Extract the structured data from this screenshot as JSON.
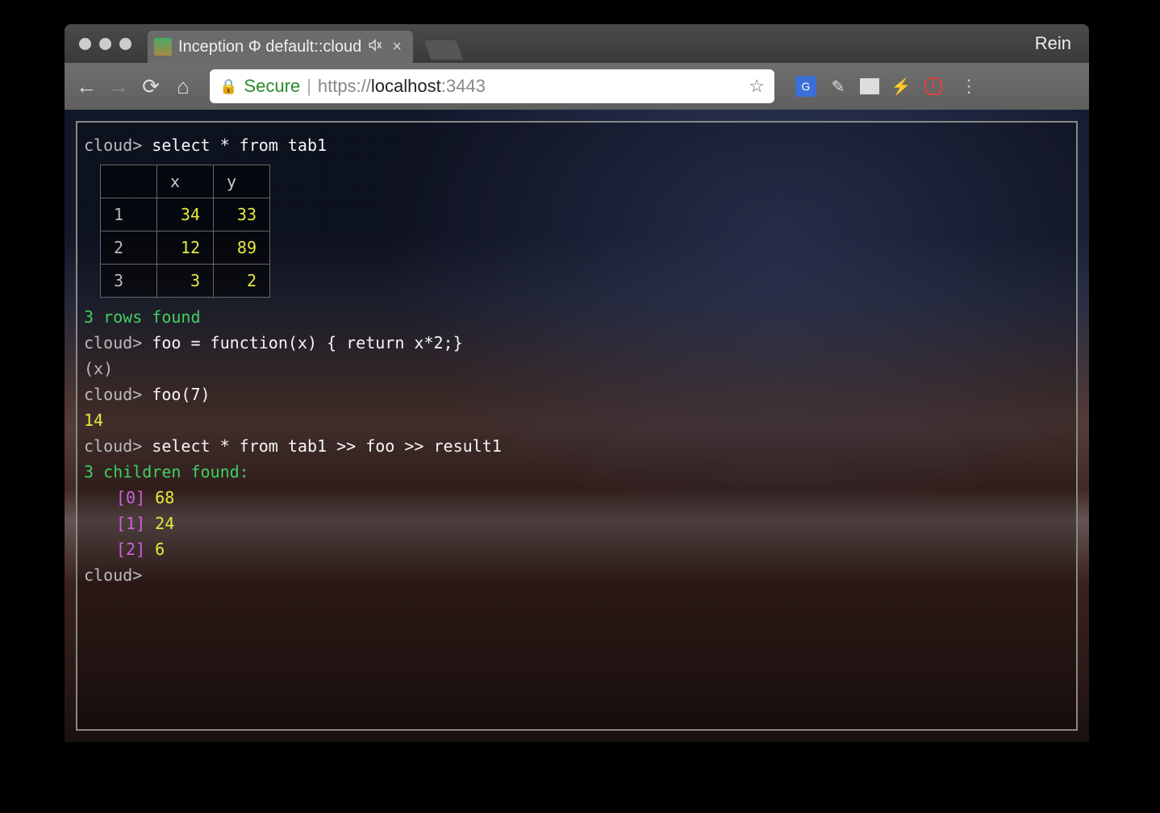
{
  "window": {
    "tab_title": "Inception Φ default::cloud",
    "muted_icon": "🔇",
    "close_glyph": "×",
    "profile": "Rein"
  },
  "toolbar": {
    "secure_label": "Secure",
    "url_proto": "https://",
    "url_host": "localhost",
    "url_port": ":3443"
  },
  "terminal": {
    "prompt": "cloud>",
    "lines": {
      "cmd1": "select * from tab1",
      "rows_found": "3 rows found",
      "cmd2": "foo = function(x) { return x*2;}",
      "func_sig": "(x)",
      "cmd3": "foo(7)",
      "result3": "14",
      "cmd4": "select * from tab1 >> foo >> result1",
      "children_found": "3 children found:"
    },
    "table": {
      "headers": [
        "",
        "x",
        "y"
      ],
      "rows": [
        {
          "n": "1",
          "x": "34",
          "y": "33"
        },
        {
          "n": "2",
          "x": "12",
          "y": "89"
        },
        {
          "n": "3",
          "x": "3",
          "y": "2"
        }
      ]
    },
    "children": [
      {
        "idx": "[0]",
        "val": "68"
      },
      {
        "idx": "[1]",
        "val": "24"
      },
      {
        "idx": "[2]",
        "val": "6"
      }
    ]
  },
  "chart_data": {
    "type": "table",
    "title": "tab1",
    "columns": [
      "x",
      "y"
    ],
    "rows": [
      {
        "x": 34,
        "y": 33
      },
      {
        "x": 12,
        "y": 89
      },
      {
        "x": 3,
        "y": 2
      }
    ],
    "derived_result1": [
      68,
      24,
      6
    ]
  }
}
